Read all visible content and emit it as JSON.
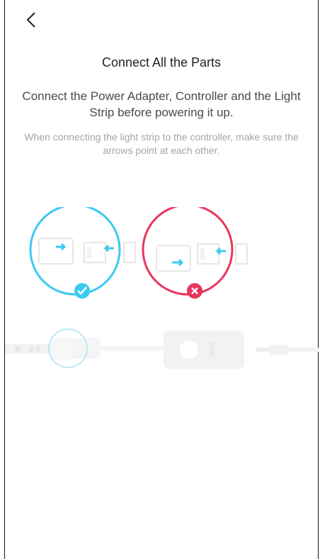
{
  "header": {
    "back_icon": "chevron-left-icon"
  },
  "content": {
    "title": "Connect All the Parts",
    "subtitle": "Connect the Power Adapter, Controller and the Light Strip before powering it up.",
    "hint": "When connecting the light strip to the controller, make sure the arrows point at each other."
  },
  "illustration": {
    "correct": {
      "status_icon": "check-icon",
      "color": "#3ccaf0"
    },
    "incorrect": {
      "status_icon": "x-icon",
      "color": "#e8365d"
    },
    "arrow_color": "#3ccaf0",
    "controller_brand": "tapo"
  }
}
